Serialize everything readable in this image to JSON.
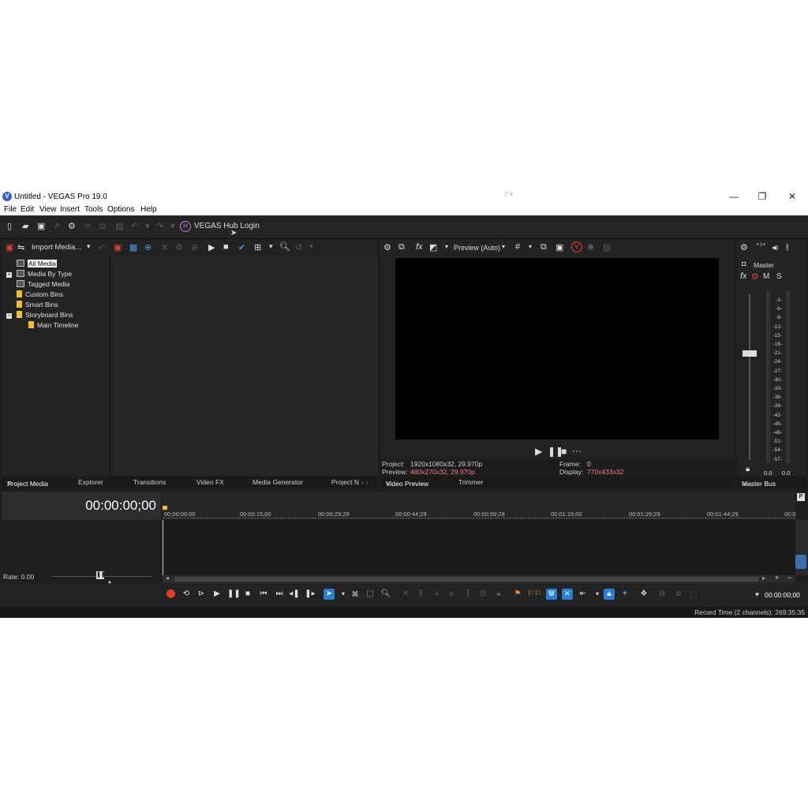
{
  "window": {
    "logo_letter": "V",
    "title": "Untitled - VEGAS Pro 19.0",
    "minimize": "—",
    "restore": "❐",
    "close": "✕"
  },
  "menu": [
    "File",
    "Edit",
    "View",
    "Insert",
    "Tools",
    "Options",
    "Help"
  ],
  "main_toolbar": {
    "hub_icon_letter": "H",
    "hub_login": "VEGAS Hub Login"
  },
  "project_media": {
    "import_label": "Import Media...",
    "tree": [
      {
        "label": "All Media",
        "selected": true
      },
      {
        "label": "Media By Type"
      },
      {
        "label": "Tagged Media"
      },
      {
        "label": "Custom Bins"
      },
      {
        "label": "Smart Bins"
      },
      {
        "label": "Storyboard Bins"
      },
      {
        "label": "Main Timeline"
      }
    ]
  },
  "left_tabs": [
    "Project Media",
    "Explorer",
    "Transitions",
    "Video FX",
    "Media Generator",
    "Project N"
  ],
  "preview": {
    "mode": "Preview (Auto)",
    "project_label": "Project:",
    "project_value": "1920x1080x32, 29.970p",
    "preview_label": "Preview:",
    "preview_value": "480x270x32, 29.970p",
    "frame_label": "Frame:",
    "frame_value": "0",
    "display_label": "Display:",
    "display_value": "770x433x32",
    "tabs": [
      "Video Preview",
      "Trimmer"
    ],
    "more": "···"
  },
  "master": {
    "label": "Master",
    "fx": "fx",
    "m": "M",
    "s": "S",
    "ticks": [
      "3",
      "6",
      "9",
      "12",
      "15",
      "18",
      "21",
      "24",
      "27",
      "30",
      "33",
      "36",
      "39",
      "42",
      "45",
      "48",
      "51",
      "54",
      "57"
    ],
    "left_value": "0.0",
    "right_value": "0.0",
    "tab": "Master Bus"
  },
  "timeline": {
    "timecode": "00:00:00;00",
    "ruler": [
      "00:00:00;00",
      "00:00:15;00",
      "00:00:29;29",
      "00:00:44;29",
      "00:00:59;28",
      "00:01:15;00",
      "00:01:29;29",
      "00:01:44;29",
      "00:0"
    ],
    "p_marker": "P",
    "rate_label": "Rate: 0.00",
    "end_time": "00:00:00;00",
    "record_time": "Record Time (2 channels): 269:35:35"
  },
  "colors": {
    "accent_blue": "#2a7fd4",
    "record_red": "#e0402a",
    "folder_yellow": "#f0c030",
    "hub_purple": "#b57edc",
    "value_pink": "#ff7a7a"
  }
}
